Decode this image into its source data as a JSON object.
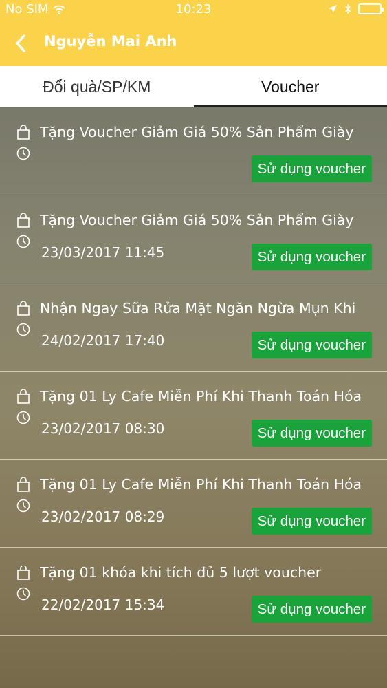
{
  "status_bar": {
    "carrier": "No SIM",
    "time": "10:23",
    "icons": [
      "wifi-icon",
      "location-icon",
      "bluetooth-icon",
      "battery-icon"
    ]
  },
  "nav": {
    "title": "Nguyễn Mai Anh",
    "back_icon": "chevron-left-icon"
  },
  "tabs": [
    {
      "label": "Đổi quà/SP/KM",
      "active": false
    },
    {
      "label": "Voucher",
      "active": true
    }
  ],
  "vouchers": [
    {
      "title": "Tặng Voucher Giảm Giá 50% Sản Phẩm Giày",
      "date": "",
      "button": "Sử dụng voucher"
    },
    {
      "title": "Tặng Voucher Giảm Giá 50% Sản Phẩm Giày",
      "date": "23/03/2017 11:45",
      "button": "Sử dụng voucher"
    },
    {
      "title": "Nhận Ngay Sữa Rửa Mặt Ngăn Ngừa Mụn Khi",
      "date": "24/02/2017 17:40",
      "button": "Sử dụng voucher"
    },
    {
      "title": "Tặng 01 Ly Cafe Miễn Phí Khi Thanh Toán Hóa",
      "date": "23/02/2017 08:30",
      "button": "Sử dụng voucher"
    },
    {
      "title": "Tặng 01 Ly Cafe Miễn Phí Khi Thanh Toán Hóa",
      "date": "23/02/2017 08:29",
      "button": "Sử dụng voucher"
    },
    {
      "title": "Tặng 01 khóa khi tích đủ 5 lượt voucher",
      "date": "22/02/2017 15:34",
      "button": "Sử dụng voucher"
    }
  ],
  "colors": {
    "header": "#fbd34a",
    "button": "#1aa33a"
  }
}
